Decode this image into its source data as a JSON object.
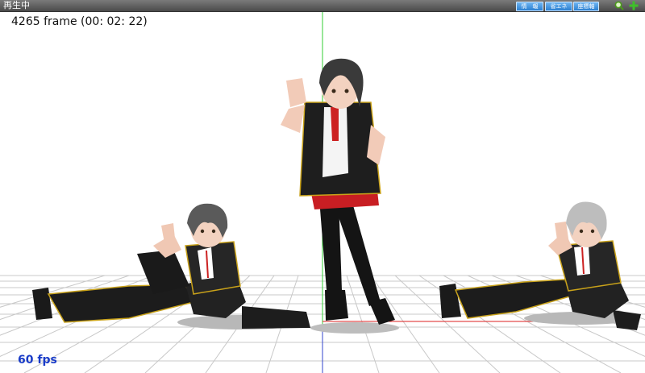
{
  "window": {
    "title": "再生中"
  },
  "toolbar": {
    "buttons": [
      {
        "label": "情　報"
      },
      {
        "label": "省エネ"
      },
      {
        "label": "座標軸"
      }
    ],
    "icons": [
      "zoom-icon",
      "add-icon"
    ]
  },
  "viewport": {
    "frame_text": "4265 frame (00: 02: 22)",
    "fps_text": "60 fps",
    "colors": {
      "y_axis": "#33cc33",
      "z_axis": "#3344cc",
      "x_axis": "#dd2222",
      "grid": "#c8c8c8",
      "fps": "#1a3cc8"
    },
    "models": [
      "seated-model-left",
      "standing-model-center",
      "seated-model-right"
    ]
  }
}
